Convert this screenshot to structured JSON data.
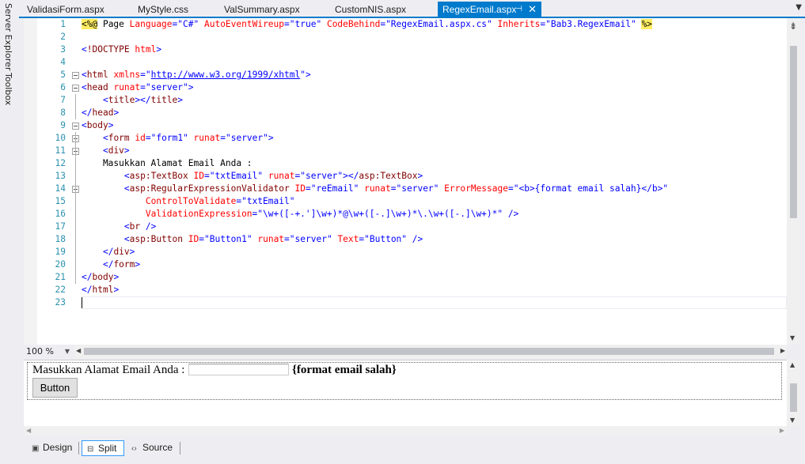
{
  "side_tabs": [
    "Server Explorer",
    "Toolbox"
  ],
  "tabs": [
    {
      "label": "ValidasiForm.aspx",
      "active": false
    },
    {
      "label": "MyStyle.css",
      "active": false
    },
    {
      "label": "ValSummary.aspx",
      "active": false
    },
    {
      "label": "CustomNIS.aspx",
      "active": false
    },
    {
      "label": "RegexEmail.aspx",
      "active": true
    }
  ],
  "tab_icons": {
    "pin": "pin-icon",
    "close": "close-icon",
    "overflow": "chevron-down-icon"
  },
  "code_lines": [
    {
      "n": "1",
      "fold": false,
      "tokens": [
        [
          "dir",
          "<%@"
        ],
        [
          "text",
          " Page "
        ],
        [
          "attr",
          "Language"
        ],
        [
          "punct",
          "="
        ],
        [
          "val",
          "\"C#\""
        ],
        [
          "text",
          " "
        ],
        [
          "attr",
          "AutoEventWireup"
        ],
        [
          "punct",
          "="
        ],
        [
          "val",
          "\"true\""
        ],
        [
          "text",
          " "
        ],
        [
          "attr",
          "CodeBehind"
        ],
        [
          "punct",
          "="
        ],
        [
          "val",
          "\"RegexEmail.aspx.cs\""
        ],
        [
          "text",
          " "
        ],
        [
          "attr",
          "Inherits"
        ],
        [
          "punct",
          "="
        ],
        [
          "val",
          "\"Bab3.RegexEmail\""
        ],
        [
          "text",
          " "
        ],
        [
          "dir",
          "%>"
        ]
      ]
    },
    {
      "n": "2",
      "fold": false,
      "tokens": []
    },
    {
      "n": "3",
      "fold": false,
      "tokens": [
        [
          "punct",
          "<"
        ],
        [
          "tag",
          "!DOCTYPE"
        ],
        [
          "text",
          " "
        ],
        [
          "attr",
          "html"
        ],
        [
          "punct",
          ">"
        ]
      ]
    },
    {
      "n": "4",
      "fold": false,
      "tokens": []
    },
    {
      "n": "5",
      "fold": true,
      "tokens": [
        [
          "punct",
          "<"
        ],
        [
          "tag",
          "html"
        ],
        [
          "text",
          " "
        ],
        [
          "attr",
          "xmlns"
        ],
        [
          "punct",
          "="
        ],
        [
          "val",
          "\""
        ],
        [
          "link",
          "http://www.w3.org/1999/xhtml"
        ],
        [
          "val",
          "\""
        ],
        [
          "punct",
          ">"
        ]
      ]
    },
    {
      "n": "6",
      "fold": true,
      "tokens": [
        [
          "punct",
          "<"
        ],
        [
          "tag",
          "head"
        ],
        [
          "text",
          " "
        ],
        [
          "attr",
          "runat"
        ],
        [
          "punct",
          "="
        ],
        [
          "val",
          "\"server\""
        ],
        [
          "punct",
          ">"
        ]
      ]
    },
    {
      "n": "7",
      "fold": false,
      "tokens": [
        [
          "text",
          "    "
        ],
        [
          "punct",
          "<"
        ],
        [
          "tag",
          "title"
        ],
        [
          "punct",
          "></"
        ],
        [
          "tag",
          "title"
        ],
        [
          "punct",
          ">"
        ]
      ]
    },
    {
      "n": "8",
      "fold": false,
      "tokens": [
        [
          "punct",
          "</"
        ],
        [
          "tag",
          "head"
        ],
        [
          "punct",
          ">"
        ]
      ]
    },
    {
      "n": "9",
      "fold": true,
      "tokens": [
        [
          "punct",
          "<"
        ],
        [
          "tag",
          "body"
        ],
        [
          "punct",
          ">"
        ]
      ]
    },
    {
      "n": "10",
      "fold": true,
      "tokens": [
        [
          "text",
          "    "
        ],
        [
          "punct",
          "<"
        ],
        [
          "tag",
          "form"
        ],
        [
          "text",
          " "
        ],
        [
          "attr",
          "id"
        ],
        [
          "punct",
          "="
        ],
        [
          "val",
          "\"form1\""
        ],
        [
          "text",
          " "
        ],
        [
          "attr",
          "runat"
        ],
        [
          "punct",
          "="
        ],
        [
          "val",
          "\"server\""
        ],
        [
          "punct",
          ">"
        ]
      ]
    },
    {
      "n": "11",
      "fold": true,
      "tokens": [
        [
          "text",
          "    "
        ],
        [
          "punct",
          "<"
        ],
        [
          "tag",
          "div"
        ],
        [
          "punct",
          ">"
        ]
      ]
    },
    {
      "n": "12",
      "fold": false,
      "tokens": [
        [
          "text",
          "    Masukkan Alamat Email Anda :"
        ]
      ]
    },
    {
      "n": "13",
      "fold": false,
      "tokens": [
        [
          "text",
          "        "
        ],
        [
          "punct",
          "<"
        ],
        [
          "tag",
          "asp:TextBox"
        ],
        [
          "text",
          " "
        ],
        [
          "attr",
          "ID"
        ],
        [
          "punct",
          "="
        ],
        [
          "val",
          "\"txtEmail\""
        ],
        [
          "text",
          " "
        ],
        [
          "attr",
          "runat"
        ],
        [
          "punct",
          "="
        ],
        [
          "val",
          "\"server\""
        ],
        [
          "punct",
          "></"
        ],
        [
          "tag",
          "asp:TextBox"
        ],
        [
          "punct",
          ">"
        ]
      ]
    },
    {
      "n": "14",
      "fold": true,
      "tokens": [
        [
          "text",
          "        "
        ],
        [
          "punct",
          "<"
        ],
        [
          "tag",
          "asp:RegularExpressionValidator"
        ],
        [
          "text",
          " "
        ],
        [
          "attr",
          "ID"
        ],
        [
          "punct",
          "="
        ],
        [
          "val",
          "\"reEmail\""
        ],
        [
          "text",
          " "
        ],
        [
          "attr",
          "runat"
        ],
        [
          "punct",
          "="
        ],
        [
          "val",
          "\"server\""
        ],
        [
          "text",
          " "
        ],
        [
          "attr",
          "ErrorMessage"
        ],
        [
          "punct",
          "="
        ],
        [
          "val",
          "\"<b>{format email salah}</b>\""
        ]
      ]
    },
    {
      "n": "15",
      "fold": false,
      "tokens": [
        [
          "text",
          "            "
        ],
        [
          "attr",
          "ControlToValidate"
        ],
        [
          "punct",
          "="
        ],
        [
          "val",
          "\"txtEmail\""
        ]
      ]
    },
    {
      "n": "16",
      "fold": false,
      "tokens": [
        [
          "text",
          "            "
        ],
        [
          "attr",
          "ValidationExpression"
        ],
        [
          "punct",
          "="
        ],
        [
          "val",
          "\"\\w+([-+.']\\w+)*@\\w+([-.]\\w+)*\\.\\w+([-.]\\w+)*\""
        ],
        [
          "text",
          " "
        ],
        [
          "punct",
          "/>"
        ]
      ]
    },
    {
      "n": "17",
      "fold": false,
      "tokens": [
        [
          "text",
          "        "
        ],
        [
          "punct",
          "<"
        ],
        [
          "tag",
          "br"
        ],
        [
          "text",
          " "
        ],
        [
          "punct",
          "/>"
        ]
      ]
    },
    {
      "n": "18",
      "fold": false,
      "tokens": [
        [
          "text",
          "        "
        ],
        [
          "punct",
          "<"
        ],
        [
          "tag",
          "asp:Button"
        ],
        [
          "text",
          " "
        ],
        [
          "attr",
          "ID"
        ],
        [
          "punct",
          "="
        ],
        [
          "val",
          "\"Button1\""
        ],
        [
          "text",
          " "
        ],
        [
          "attr",
          "runat"
        ],
        [
          "punct",
          "="
        ],
        [
          "val",
          "\"server\""
        ],
        [
          "text",
          " "
        ],
        [
          "attr",
          "Text"
        ],
        [
          "punct",
          "="
        ],
        [
          "val",
          "\"Button\""
        ],
        [
          "text",
          " "
        ],
        [
          "punct",
          "/>"
        ]
      ]
    },
    {
      "n": "19",
      "fold": false,
      "tokens": [
        [
          "text",
          "    "
        ],
        [
          "punct",
          "</"
        ],
        [
          "tag",
          "div"
        ],
        [
          "punct",
          ">"
        ]
      ]
    },
    {
      "n": "20",
      "fold": false,
      "tokens": [
        [
          "text",
          "    "
        ],
        [
          "punct",
          "</"
        ],
        [
          "tag",
          "form"
        ],
        [
          "punct",
          ">"
        ]
      ]
    },
    {
      "n": "21",
      "fold": false,
      "tokens": [
        [
          "punct",
          "</"
        ],
        [
          "tag",
          "body"
        ],
        [
          "punct",
          ">"
        ]
      ]
    },
    {
      "n": "22",
      "fold": false,
      "tokens": [
        [
          "punct",
          "</"
        ],
        [
          "tag",
          "html"
        ],
        [
          "punct",
          ">"
        ]
      ]
    },
    {
      "n": "23",
      "fold": false,
      "tokens": []
    }
  ],
  "zoom": "100 %",
  "design": {
    "label": "Masukkan Alamat Email Anda :",
    "error": "{format email salah}",
    "button": "Button"
  },
  "view_buttons": [
    {
      "label": "Design",
      "icon": "design-view-icon",
      "active": false
    },
    {
      "label": "Split",
      "icon": "split-view-icon",
      "active": true
    },
    {
      "label": "Source",
      "icon": "source-view-icon",
      "active": false
    }
  ],
  "colors": {
    "accent": "#007acc",
    "tag": "#800000",
    "attr": "#ff0000",
    "value": "#0000ff",
    "line_number": "#2b91af",
    "directive_highlight": "#ffee62"
  }
}
